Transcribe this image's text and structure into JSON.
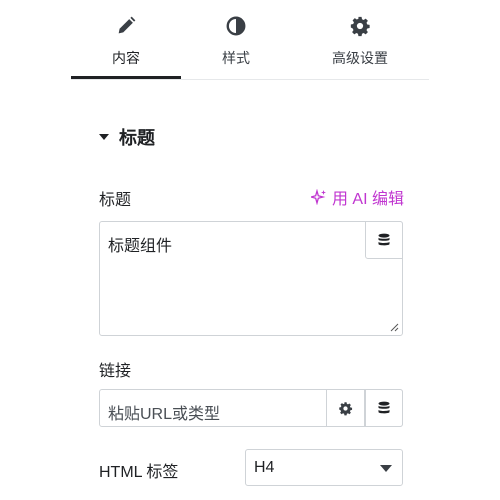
{
  "tabs": [
    {
      "label": "内容",
      "icon": "pencil-icon",
      "active": true
    },
    {
      "label": "样式",
      "icon": "half-circle-icon",
      "active": false
    },
    {
      "label": "高级设置",
      "icon": "gear-icon",
      "active": false
    }
  ],
  "section": {
    "title": "标题",
    "icon": "caret-down-icon"
  },
  "title_field": {
    "label": "标题",
    "ai_link": "用 AI 编辑",
    "ai_icon": "sparkle-icon",
    "value": "标题组件",
    "dynamic_icon": "database-icon"
  },
  "link_field": {
    "label": "链接",
    "placeholder": "粘贴URL或类型",
    "settings_icon": "gear-icon",
    "dynamic_icon": "database-icon"
  },
  "html_tag_field": {
    "label": "HTML 标签",
    "selected": "H4"
  },
  "colors": {
    "ai_accent": "#c036d0",
    "active_indicator": "#1f2124",
    "border": "#cfd3d7"
  }
}
